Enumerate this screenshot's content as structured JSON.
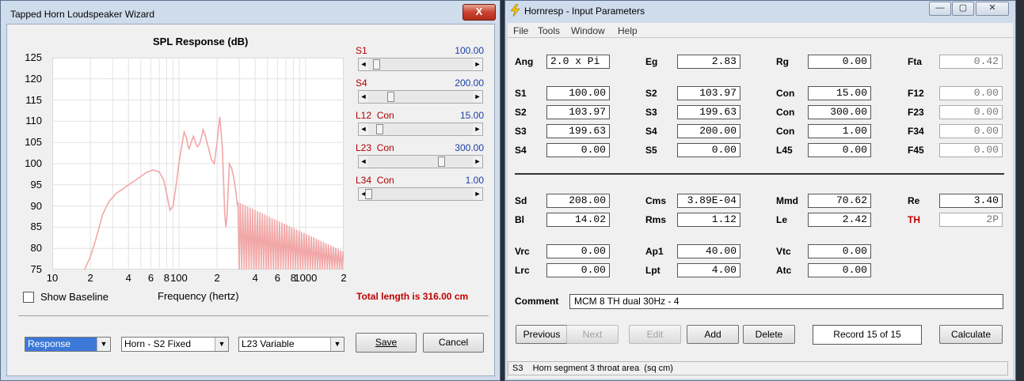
{
  "wizard": {
    "title": "Tapped Horn Loudspeaker Wizard",
    "close_label": "X",
    "chart_title": "SPL Response (dB)",
    "sliders": [
      {
        "label": "S1",
        "value": "100.00"
      },
      {
        "label": "S4",
        "value": "200.00"
      },
      {
        "label": "L12  Con",
        "value": "15.00"
      },
      {
        "label": "L23  Con",
        "value": "300.00"
      },
      {
        "label": "L34  Con",
        "value": "1.00"
      }
    ],
    "show_baseline_label": "Show Baseline",
    "total_length": "Total length is 316.00 cm",
    "combo_response": "Response",
    "combo_horn": "Horn - S2 Fixed",
    "combo_l23": "L23 Variable",
    "save_label": "Save",
    "cancel_label": "Cancel"
  },
  "chart_data": {
    "type": "line",
    "title": "SPL Response (dB)",
    "xlabel": "Frequency (hertz)",
    "ylabel": "",
    "xscale": "log",
    "xlim": [
      10,
      2000
    ],
    "ylim": [
      75,
      125
    ],
    "yticks": [
      "125",
      "120",
      "115",
      "110",
      "105",
      "100",
      "95",
      "90",
      "85",
      "80",
      "75"
    ],
    "xticks": [
      "10",
      "2",
      "4",
      "6",
      "8",
      "100",
      "2",
      "4",
      "6",
      "8",
      "1000",
      "2"
    ],
    "grid": true,
    "color": "#f2a7a7",
    "x": [
      18,
      20,
      22,
      25,
      28,
      32,
      36,
      40,
      45,
      50,
      56,
      63,
      70,
      76,
      80,
      85,
      90,
      95,
      100,
      105,
      110,
      115,
      118,
      120,
      122,
      125,
      130,
      135,
      140,
      145,
      150,
      155,
      160,
      170,
      180,
      190,
      200,
      210,
      220,
      225,
      230,
      235,
      240,
      250,
      260,
      270,
      280,
      290
    ],
    "y": [
      75,
      78,
      82,
      88,
      91,
      93,
      94,
      95,
      96,
      97,
      98,
      98.5,
      98,
      96,
      93,
      89,
      90,
      95,
      100,
      104,
      107.5,
      106,
      104,
      103.5,
      104,
      105,
      106.5,
      105,
      104,
      104.5,
      106,
      108,
      107,
      104,
      101,
      100,
      105,
      111,
      104,
      96,
      88,
      85,
      88,
      100,
      99,
      97,
      94,
      90
    ]
  },
  "hornresp": {
    "title": "Hornresp - Input Parameters",
    "menu": [
      "File",
      "Tools",
      "Window",
      "Help"
    ],
    "rows": [
      [
        {
          "label": "Ang",
          "value": "2.0 x Pi"
        },
        {
          "label": "Eg",
          "value": "2.83"
        },
        {
          "label": "Rg",
          "value": "0.00"
        },
        {
          "label": "Fta",
          "value": "0.42",
          "dis": true
        }
      ],
      [
        {
          "label": "S1",
          "value": "100.00"
        },
        {
          "label": "S2",
          "value": "103.97"
        },
        {
          "label": "Con",
          "value": "15.00"
        },
        {
          "label": "F12",
          "value": "0.00",
          "dis": true
        }
      ],
      [
        {
          "label": "S2",
          "value": "103.97"
        },
        {
          "label": "S3",
          "value": "199.63"
        },
        {
          "label": "Con",
          "value": "300.00"
        },
        {
          "label": "F23",
          "value": "0.00",
          "dis": true
        }
      ],
      [
        {
          "label": "S3",
          "value": "199.63"
        },
        {
          "label": "S4",
          "value": "200.00"
        },
        {
          "label": "Con",
          "value": "1.00"
        },
        {
          "label": "F34",
          "value": "0.00",
          "dis": true
        }
      ],
      [
        {
          "label": "S4",
          "value": "0.00"
        },
        {
          "label": "S5",
          "value": "0.00"
        },
        {
          "label": "L45",
          "value": "0.00"
        },
        {
          "label": "F45",
          "value": "0.00",
          "dis": true
        }
      ],
      [
        {
          "label": "Sd",
          "value": "208.00"
        },
        {
          "label": "Cms",
          "value": "3.89E-04"
        },
        {
          "label": "Mmd",
          "value": "70.62"
        },
        {
          "label": "Re",
          "value": "3.40"
        }
      ],
      [
        {
          "label": "Bl",
          "value": "14.02"
        },
        {
          "label": "Rms",
          "value": "1.12"
        },
        {
          "label": "Le",
          "value": "2.42"
        },
        {
          "label": "TH",
          "value": "2P",
          "dis": true,
          "red": true
        }
      ],
      [
        {
          "label": "Vrc",
          "value": "0.00"
        },
        {
          "label": "Ap1",
          "value": "40.00"
        },
        {
          "label": "Vtc",
          "value": "0.00"
        }
      ],
      [
        {
          "label": "Lrc",
          "value": "0.00"
        },
        {
          "label": "Lpt",
          "value": "4.00"
        },
        {
          "label": "Atc",
          "value": "0.00"
        }
      ]
    ],
    "comment_label": "Comment",
    "comment_value": "MCM 8 TH dual 30Hz - 4",
    "buttons": {
      "previous": "Previous",
      "next": "Next",
      "edit": "Edit",
      "add": "Add",
      "delete": "Delete",
      "record": "Record 15 of 15",
      "calculate": "Calculate"
    },
    "status": "S3    Horn segment 3 throat area  (sq cm)"
  }
}
